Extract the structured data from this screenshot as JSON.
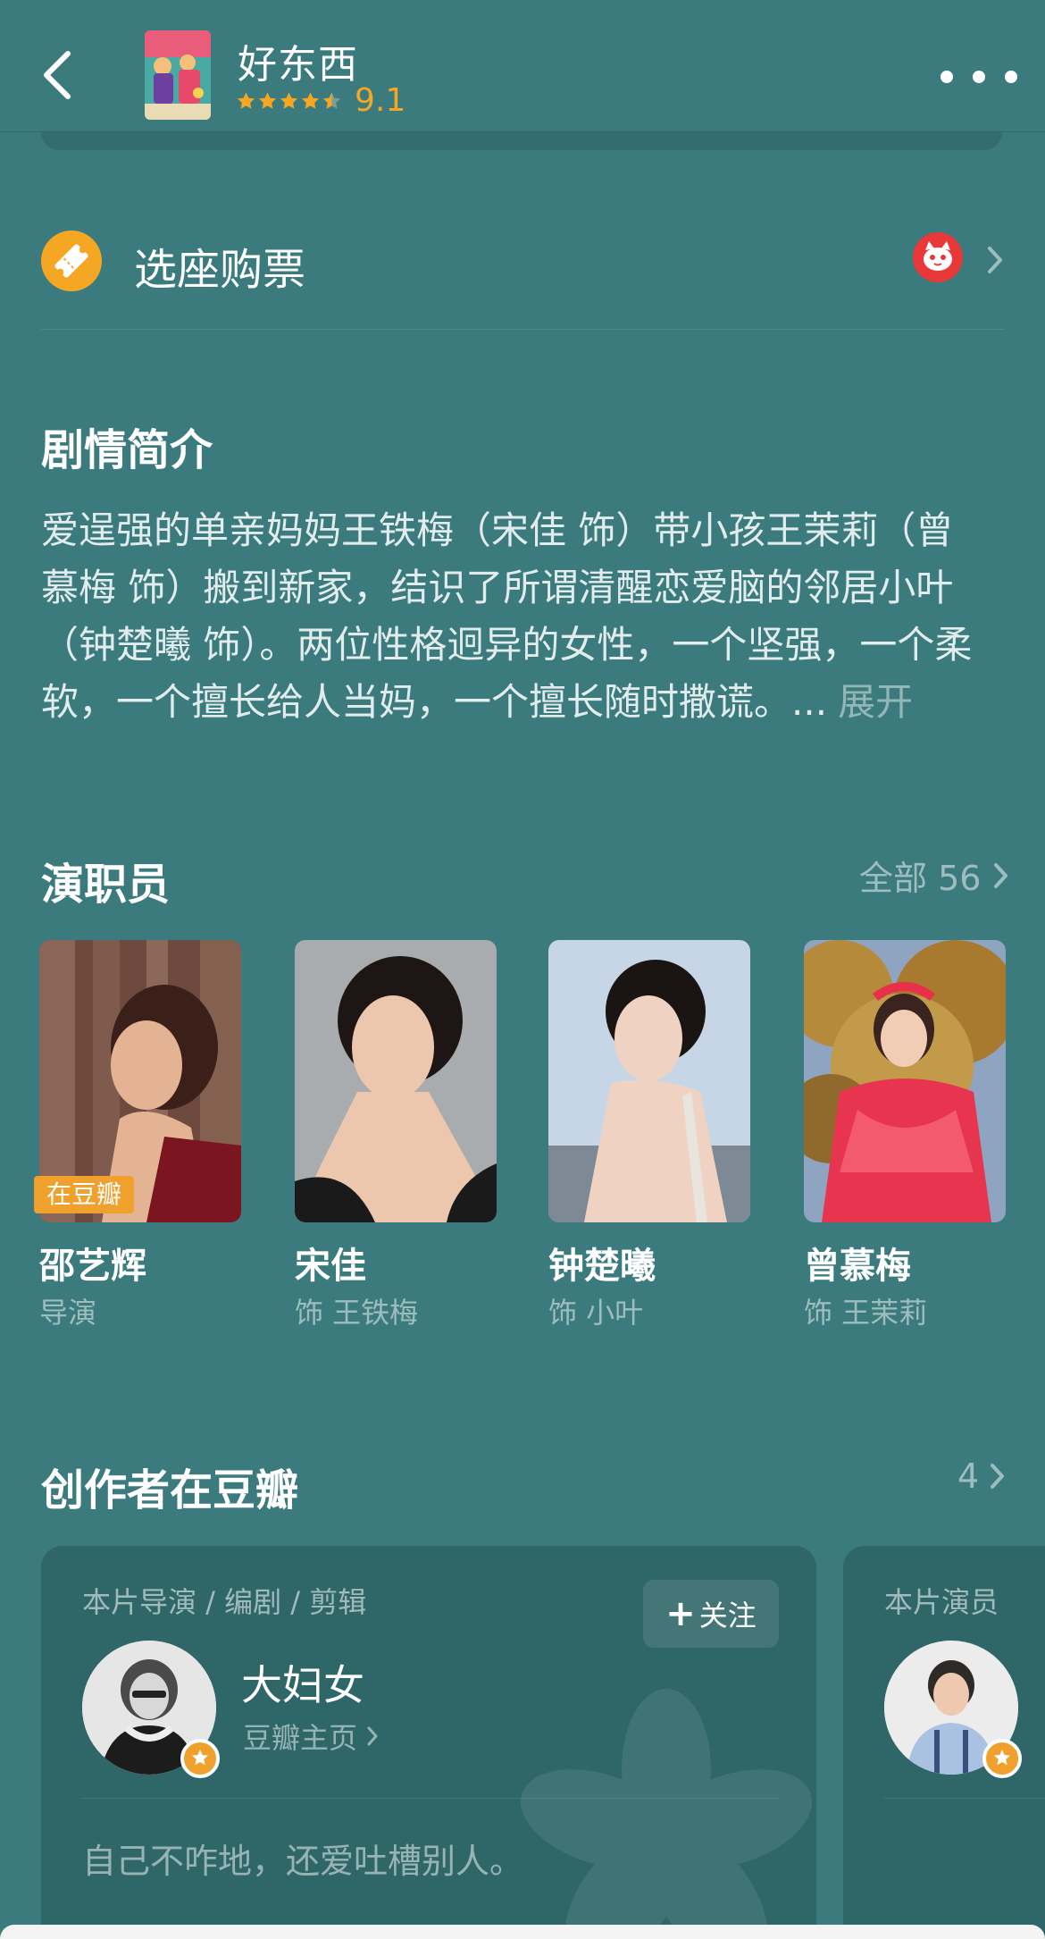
{
  "header": {
    "title": "好东西",
    "score": "9.1",
    "star_rating": 4.5
  },
  "ticket": {
    "label": "选座购票"
  },
  "synopsis": {
    "title": "剧情简介",
    "lines": [
      "爱逞强的单亲妈妈王铁梅（宋佳 饰）带小孩王茉莉（曾",
      "慕梅 饰）搬到新家，结识了所谓清醒恋爱脑的邻居小叶",
      "（钟楚曦 饰）。两位性格迥异的女性，一个坚强，一个柔",
      "软，一个擅长给人当妈，一个擅长随时撒谎。..."
    ],
    "expand_label": "展开"
  },
  "cast": {
    "title": "演职员",
    "see_all_label": "全部 56",
    "members": [
      {
        "name": "邵艺辉",
        "role": "导演",
        "badge": "在豆瓣"
      },
      {
        "name": "宋佳",
        "role": "饰 王铁梅"
      },
      {
        "name": "钟楚曦",
        "role": "饰 小叶"
      },
      {
        "name": "曾慕梅",
        "role": "饰 王茉莉"
      }
    ]
  },
  "creators": {
    "title": "创作者在豆瓣",
    "count": "4",
    "cards": [
      {
        "subtitle": "本片导演 / 编剧 / 剪辑",
        "follow_label": "关注",
        "name": "大妇女",
        "homepage_label": "豆瓣主页",
        "quote": "自己不咋地，还爱吐槽别人。"
      },
      {
        "subtitle": "本片演员"
      }
    ]
  },
  "colors": {
    "background": "#3b7b7d",
    "card": "#2f6769",
    "accent_orange": "#f0a02d",
    "rating_yellow": "#f5a623",
    "maoyan_red": "#e8383a"
  },
  "icons": [
    "back-icon",
    "more-icon",
    "ticket-icon",
    "maoyan-cat-icon",
    "chevron-right-icon",
    "plus-icon",
    "verified-badge-icon"
  ]
}
